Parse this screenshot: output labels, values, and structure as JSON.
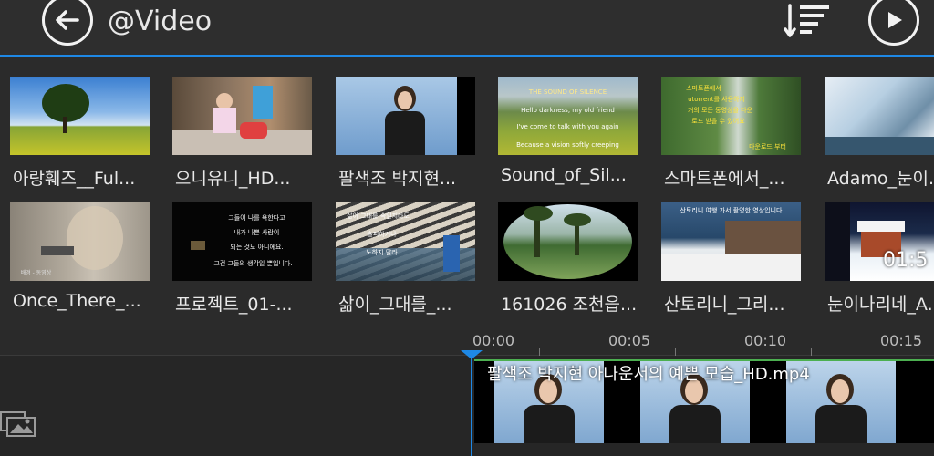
{
  "header": {
    "title": "@Video",
    "back_icon": "arrow-left-icon",
    "sort_icon": "sort-icon",
    "play_icon": "play-icon",
    "accent_color": "#1e88e5"
  },
  "grid": {
    "items": [
      {
        "label": "아랑훼즈__Ful...",
        "thumb": "tree-field"
      },
      {
        "label": "으니유니_HD...",
        "thumb": "child-room"
      },
      {
        "label": "팔색조 박지현...",
        "thumb": "news-anchor"
      },
      {
        "label": "Sound_of_Sil...",
        "thumb": "mountain-lyrics",
        "overlay": [
          "THE SOUND OF SILENCE",
          "Hello darkness, my old friend",
          "I've come to talk with you again",
          "Because a vision softly creeping"
        ]
      },
      {
        "label": "스마트폰에서_...",
        "thumb": "waterfall-text",
        "overlay": [
          "스마트폰에서",
          "utorrent를 사용하지",
          "거의 모든 동영상을 다운",
          "로드 받을 수 있어요",
          "다운로드 부터"
        ]
      },
      {
        "label": "Adamo_눈이...",
        "thumb": "glacier"
      },
      {
        "label": "Once_There_...",
        "thumb": "woman-face",
        "overlay": [
          "배경 - 동영상"
        ]
      },
      {
        "label": "프로젝트_01-...",
        "thumb": "black-poem",
        "overlay": [
          "그들이 나를 욕한다고",
          "내가 나쁜 사람이",
          "되는 것도 아니에요.",
          "그건 그들의 생각일 뿐입니다."
        ]
      },
      {
        "label": "삶이_그대를_...",
        "thumb": "steps-sea",
        "overlay": [
          "삶이 그대를 속일지라도",
          "슬퍼하거나",
          "노하지 말라"
        ]
      },
      {
        "label": "161026 조천읍...",
        "thumb": "palm-lens"
      },
      {
        "label": "산토리니_그리...",
        "thumb": "santorini",
        "overlay": [
          "산토리니 여행 가서 촬영한 영상입니다"
        ]
      },
      {
        "label": "눈이나리네_A...",
        "thumb": "snow-house",
        "overlay": [
          "01:5"
        ]
      }
    ]
  },
  "timeline": {
    "ticks": [
      "00:00",
      "00:05",
      "00:10",
      "00:15"
    ],
    "clip_title": "팔색조 박지현 아나운서의 예쁜 모습_HD.mp4",
    "media_icon": "media-library-icon"
  }
}
